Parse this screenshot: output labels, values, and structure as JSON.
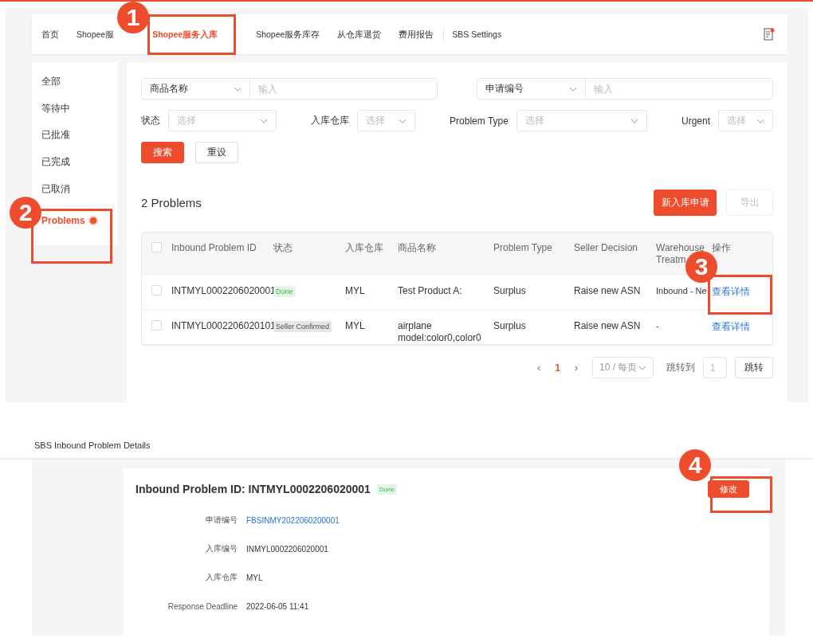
{
  "nav": {
    "tabs": [
      {
        "label": "首页",
        "selected": false,
        "divider": false
      },
      {
        "label": "Shopee服",
        "selected": false,
        "divider": false
      },
      {
        "label": "Shopee服务入库",
        "selected": true,
        "divider": false
      },
      {
        "label": "Shopee服务库存",
        "selected": false,
        "divider": false
      },
      {
        "label": "从仓库退货",
        "selected": false,
        "divider": false
      },
      {
        "label": "费用报告",
        "selected": false,
        "divider": false
      },
      {
        "label": "SBS Settings",
        "selected": false,
        "divider": true
      }
    ]
  },
  "sidebar": {
    "items": [
      {
        "label": "全部",
        "selected": false,
        "dot": false
      },
      {
        "label": "等待中",
        "selected": false,
        "dot": false
      },
      {
        "label": "已批准",
        "selected": false,
        "dot": false
      },
      {
        "label": "已完成",
        "selected": false,
        "dot": false
      },
      {
        "label": "已取消",
        "selected": false,
        "dot": false
      },
      {
        "label": "Problems",
        "selected": true,
        "dot": true
      }
    ]
  },
  "filters": {
    "search_rows": [
      {
        "select": "商品名称",
        "placeholder": "输入"
      },
      {
        "select": "申请编号",
        "placeholder": "输入"
      }
    ],
    "selects": [
      {
        "label": "状态",
        "placeholder": "选择"
      },
      {
        "label": "入库仓库",
        "placeholder": "选择"
      },
      {
        "label": "Problem Type",
        "placeholder": "选择"
      },
      {
        "label": "Urgent",
        "placeholder": "选择"
      }
    ],
    "search_button": "搜索",
    "reset_button": "重设"
  },
  "list": {
    "count": "2 Problems",
    "new_button": "新入库申请",
    "export_button": "导出"
  },
  "table": {
    "all_checked": false,
    "columns": [
      "Inbound Problem ID",
      "状态",
      "入库仓库",
      "商品名称",
      "Problem Type",
      "Seller Decision",
      "Warehouse Treatm",
      "操作"
    ],
    "rows": [
      {
        "checked": false,
        "id": "INTMYL0002206020001",
        "status": "Done",
        "color": "#e3f5e6",
        "warehouse": "MYL",
        "product": "Test Product A:",
        "problem_type": "Surplus",
        "seller_decision": "Raise new ASN",
        "treatment": "Inbound - Ne",
        "action": "查看详情"
      },
      {
        "checked": false,
        "id": "INTMYL0002206020101",
        "status": "Seller Confirmed",
        "color": "#e6e6e6",
        "warehouse": "MYL",
        "product": "airplane model:color0,color0",
        "problem_type": "Surplus",
        "seller_decision": "Raise new ASN",
        "treatment": "-",
        "action": "查看详情"
      }
    ]
  },
  "pagination": {
    "prev": "‹",
    "pages": [
      {
        "label": "1",
        "selected": true
      }
    ],
    "next": "›",
    "page_size": "10 / 每页",
    "jump_label": "跳转到",
    "jump_value": "1",
    "jump_button": "跳转"
  },
  "details": {
    "title": "SBS Inbound Problem Details",
    "heading": "Inbound Problem ID: INTMYL0002206020001",
    "status": {
      "label": "Done",
      "color": "#e3f5e6"
    },
    "edit_button": "修改",
    "fields": [
      {
        "label": "申请编号",
        "value": "FBSINMY2022060200001",
        "link": true
      },
      {
        "label": "入库编号",
        "value": "INMYL0002206020001",
        "link": false
      },
      {
        "label": "入库仓库",
        "value": "MYL",
        "link": false
      },
      {
        "label": "Response Deadline",
        "value": "2022-06-05 11:41",
        "link": false
      }
    ]
  },
  "annotations": [
    {
      "number": "1"
    },
    {
      "number": "2"
    },
    {
      "number": "3"
    },
    {
      "number": "4"
    }
  ]
}
